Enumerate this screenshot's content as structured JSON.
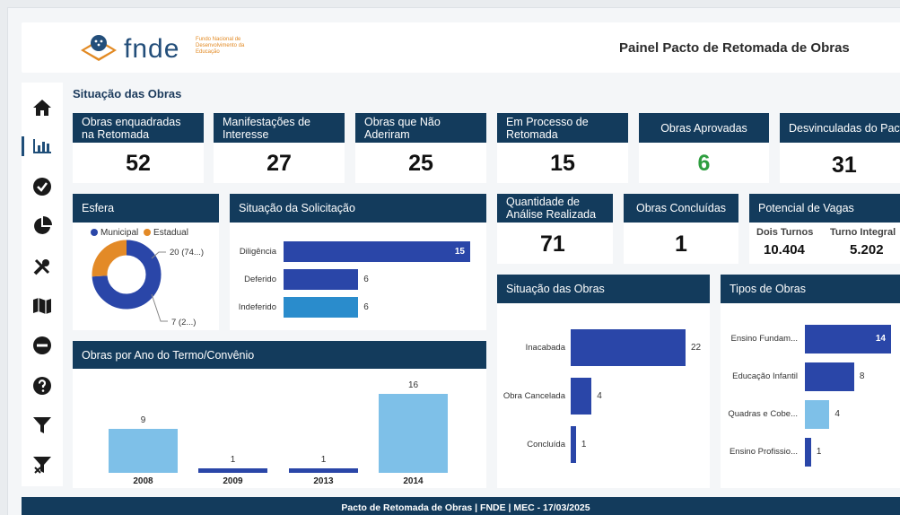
{
  "header": {
    "logo_text": "fnde",
    "logo_subtitle": "Fundo Nacional de Desenvolvimento da Educação",
    "title": "Painel Pacto de Retomada de Obras"
  },
  "sidebar": {
    "icons": [
      "home-icon",
      "bar-chart-icon",
      "check-circle-icon",
      "pie-chart-icon",
      "tools-icon",
      "map-icon",
      "minus-circle-icon",
      "help-icon",
      "filter-icon",
      "clear-filter-icon"
    ]
  },
  "section_title": "Situação das Obras",
  "kpis": [
    {
      "label": "Obras enquadradas na Retomada",
      "value": "52"
    },
    {
      "label": "Manifestações de Interesse",
      "value": "27"
    },
    {
      "label": "Obras que Não Aderiram",
      "value": "25"
    },
    {
      "label": "Em Processo de Retomada",
      "value": "15"
    },
    {
      "label": "Obras Aprovadas",
      "value": "6"
    },
    {
      "label": "Desvinculadas do Pacto",
      "value": "31"
    }
  ],
  "kpis2": [
    {
      "label": "Quantidade de Análise Realizada",
      "value": "71"
    },
    {
      "label": "Obras Concluídas",
      "value": "1"
    }
  ],
  "potencial": {
    "title": "Potencial de Vagas",
    "cols": [
      {
        "label": "Dois Turnos",
        "value": "10.404"
      },
      {
        "label": "Turno Integral",
        "value": "5.202"
      }
    ]
  },
  "colors": {
    "accent_green": "#2e9e3f",
    "header_navy": "#133b5c",
    "bar_dark": "#2a46a8",
    "bar_light": "#7ec0e8",
    "bar_mid": "#2a8ccc",
    "donut_orange": "#e38a27"
  },
  "footer": "Pacto de Retomada de Obras | FNDE | MEC  -  17/03/2025",
  "chart_data": [
    {
      "id": "esfera",
      "type": "pie",
      "title": "Esfera",
      "legend": [
        "Municipal",
        "Estadual"
      ],
      "values": [
        20,
        7
      ],
      "labels": [
        "20 (74...)",
        "7 (2...)"
      ]
    },
    {
      "id": "solicitacao",
      "type": "bar",
      "orientation": "horizontal",
      "title": "Situação da Solicitação",
      "categories": [
        "Diligência",
        "Deferido",
        "Indeferido"
      ],
      "values": [
        15,
        6,
        6
      ]
    },
    {
      "id": "situacao",
      "type": "bar",
      "orientation": "horizontal",
      "title": "Situação das Obras",
      "categories": [
        "Inacabada",
        "Obra Cancelada",
        "Concluída"
      ],
      "values": [
        22,
        4,
        1
      ]
    },
    {
      "id": "tipos",
      "type": "bar",
      "orientation": "horizontal",
      "title": "Tipos de Obras",
      "categories": [
        "Ensino Fundam...",
        "Educação Infantil",
        "Quadras e Cobe...",
        "Ensino Profissio..."
      ],
      "values": [
        14,
        8,
        4,
        1
      ]
    },
    {
      "id": "ano",
      "type": "bar",
      "title": "Obras por Ano do Termo/Convênio",
      "categories": [
        "2008",
        "2009",
        "2013",
        "2014"
      ],
      "values": [
        9,
        1,
        1,
        16
      ]
    }
  ]
}
